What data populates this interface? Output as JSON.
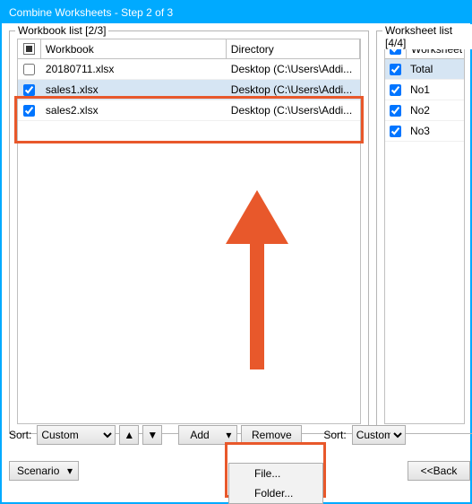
{
  "window": {
    "title": "Combine Worksheets - Step 2 of 3"
  },
  "workbook_group": {
    "label": "Workbook list [2/3]",
    "headers": {
      "workbook": "Workbook",
      "directory": "Directory"
    },
    "rows": [
      {
        "checked": false,
        "name": "20180711.xlsx",
        "dir": "Desktop (C:\\Users\\Addi..."
      },
      {
        "checked": true,
        "name": "sales1.xlsx",
        "dir": "Desktop (C:\\Users\\Addi..."
      },
      {
        "checked": true,
        "name": "sales2.xlsx",
        "dir": "Desktop (C:\\Users\\Addi..."
      }
    ]
  },
  "worksheet_group": {
    "label": "Worksheet list [4/4]",
    "header": "Worksheet",
    "rows": [
      {
        "checked": true,
        "name": "Total"
      },
      {
        "checked": true,
        "name": "No1"
      },
      {
        "checked": true,
        "name": "No2"
      },
      {
        "checked": true,
        "name": "No3"
      }
    ]
  },
  "toolbar": {
    "sort_label": "Sort:",
    "custom_option": "Custom",
    "add_label": "Add",
    "remove_label": "Remove",
    "scenario_label": "Scenario",
    "back_label": "<<Back"
  },
  "add_menu": {
    "file_label": "File...",
    "folder_label": "Folder..."
  }
}
